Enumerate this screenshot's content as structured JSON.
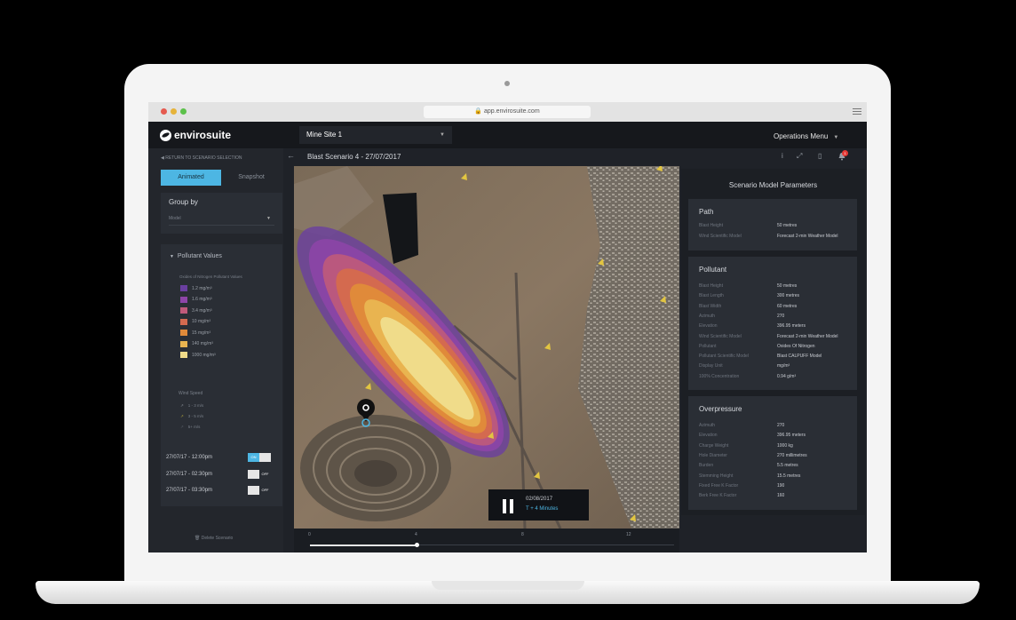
{
  "browser": {
    "url": "app.envirosuite.com",
    "dots": [
      "#e55a4f",
      "#e6b33a",
      "#5cc14a"
    ]
  },
  "app": {
    "brand": "envirosuite",
    "site_select": "Mine Site 1",
    "ops_menu": "Operations Menu"
  },
  "sidebar": {
    "back_link": "RETURN TO SCENARIO SELECTION",
    "tabs": [
      "Animated",
      "Snapshot"
    ],
    "group_by": {
      "title": "Group by",
      "value": "Model"
    },
    "pollutant": {
      "heading": "Pollutant Values",
      "subtitle": "Oxides of Nitrogen Pollutant Values",
      "legend": [
        {
          "label": "1.2 mg/m³",
          "color": "#6a3fa0"
        },
        {
          "label": "1.6 mg/m³",
          "color": "#8e45a8"
        },
        {
          "label": "3.4 mg/m³",
          "color": "#c05a7a"
        },
        {
          "label": "10 mg/m³",
          "color": "#d46a4f"
        },
        {
          "label": "15 mg/m³",
          "color": "#e08a3a"
        },
        {
          "label": "140 mg/m³",
          "color": "#e9b450"
        },
        {
          "label": "1000 mg/m³",
          "color": "#f0dc8a"
        }
      ],
      "wind_title": "Wind Speed",
      "wind": [
        {
          "label": "1 - 3 m/s",
          "color": "#8a8f98"
        },
        {
          "label": "3 - 5 m/s",
          "color": "#b3a43a"
        },
        {
          "label": "5+ m/s",
          "color": "#5a5f68"
        }
      ]
    },
    "schedule": [
      {
        "time": "27/07/17 - 12:00pm",
        "state": "ON",
        "on": true
      },
      {
        "time": "27/07/17 - 02:30pm",
        "state": "OFF",
        "on": false
      },
      {
        "time": "27/07/17 - 03:30pm",
        "state": "OFF",
        "on": false
      }
    ],
    "delete": "Delete Scenario"
  },
  "scenario": {
    "title": "Blast Scenario 4 - 27/07/2017"
  },
  "toolbar": {
    "info": "i",
    "expand": "⤢",
    "doc": "▯",
    "notifications": "1"
  },
  "timeline": {
    "labels": [
      "0",
      "4",
      "8",
      "12"
    ]
  },
  "player": {
    "date": "02/08/2017",
    "offset": "T + 4 Minutes"
  },
  "params": {
    "title": "Scenario Model Parameters",
    "path": {
      "title": "Path",
      "rows": [
        [
          "Blast Height",
          "50 metres"
        ],
        [
          "Wind Scientific Model",
          "Forecast 2-min Weather Model"
        ]
      ]
    },
    "pollutant": {
      "title": "Pollutant",
      "rows": [
        [
          "Blast Height",
          "50 metres"
        ],
        [
          "Blast Length",
          "300 metres"
        ],
        [
          "Blast Width",
          "60 metres"
        ],
        [
          "Azimuth",
          "270"
        ],
        [
          "Elevation",
          "396.95 meters"
        ],
        [
          "Wind Scientific Model",
          "Forecast 2-min Weather Model"
        ],
        [
          "Pollutant",
          "Oxides Of Nitrogen"
        ],
        [
          "Pollutant Scientific Model",
          "Blast CALPUFF Model"
        ],
        [
          "Display Unit",
          "mg/m³"
        ],
        [
          "100% Concentration",
          "0.94 g/m³"
        ]
      ]
    },
    "overpressure": {
      "title": "Overpressure",
      "rows": [
        [
          "Azimuth",
          "270"
        ],
        [
          "Elevation",
          "396.95 meters"
        ],
        [
          "Charge Weight",
          "1000 kg"
        ],
        [
          "Hole Diameter",
          "270 millimetres"
        ],
        [
          "Burden",
          "5.5 metres"
        ],
        [
          "Stemming Height",
          "15.5 metres"
        ],
        [
          "Fixed Free K Factor",
          "190"
        ],
        [
          "Berk Free K Factor",
          "160"
        ]
      ]
    }
  }
}
